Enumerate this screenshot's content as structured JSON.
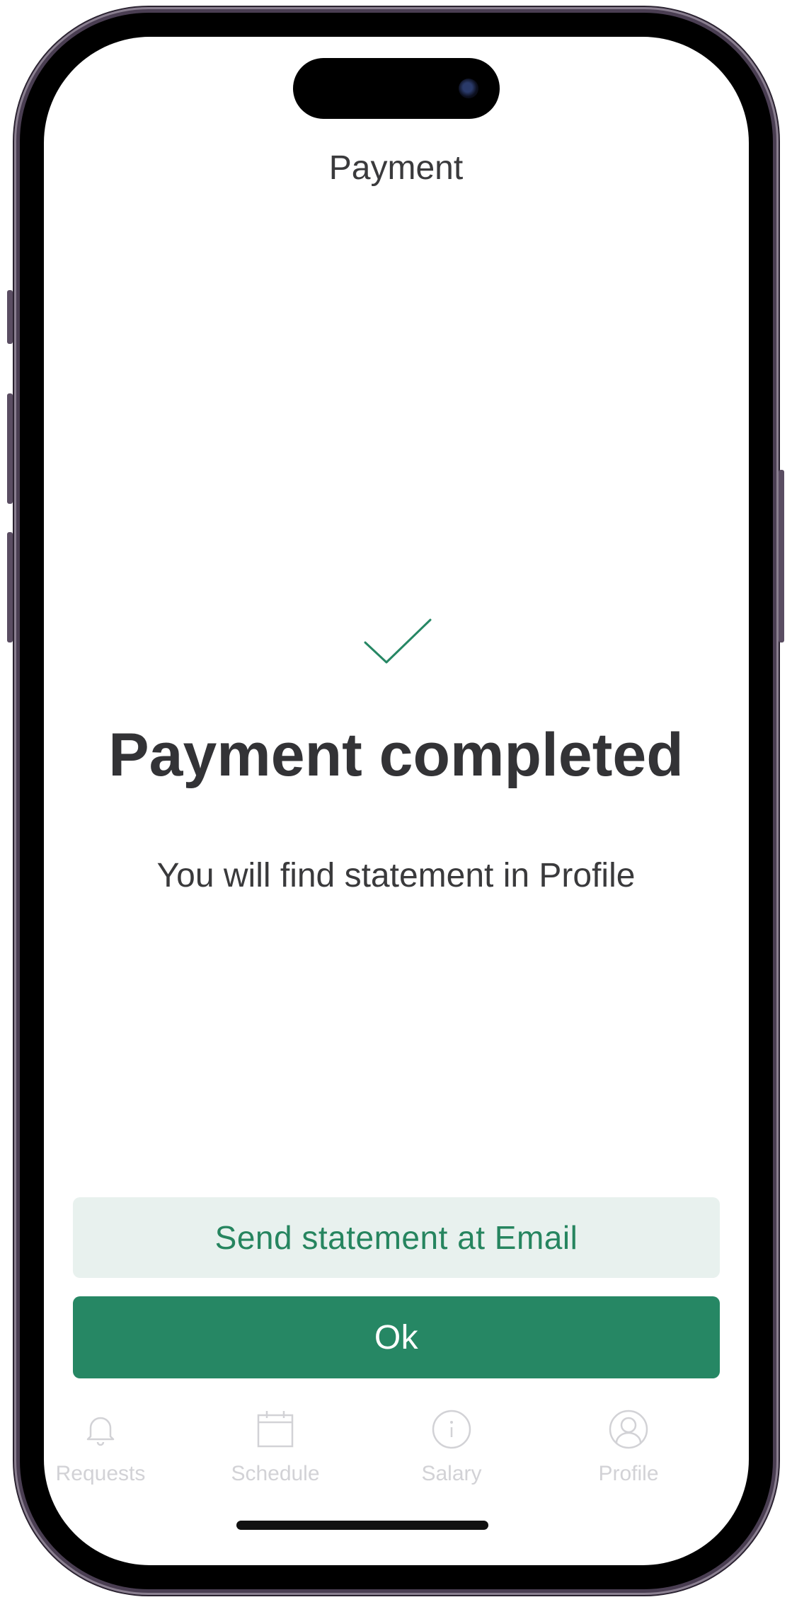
{
  "header": {
    "title": "Payment"
  },
  "status": {
    "icon": "checkmark-icon",
    "title": "Payment completed",
    "message": "You will find statement in Profile"
  },
  "actions": {
    "send_email_label": "Send statement at Email",
    "ok_label": "Ok"
  },
  "tabbar": {
    "items": [
      {
        "label": "Requests",
        "icon": "bell-icon"
      },
      {
        "label": "Schedule",
        "icon": "calendar-icon"
      },
      {
        "label": "Salary",
        "icon": "info-icon"
      },
      {
        "label": "Profile",
        "icon": "user-icon"
      }
    ]
  },
  "colors": {
    "accent": "#268764",
    "accent_light": "#e8f1ee",
    "text_dark": "#333336",
    "tab_inactive": "#d2d2d6"
  }
}
